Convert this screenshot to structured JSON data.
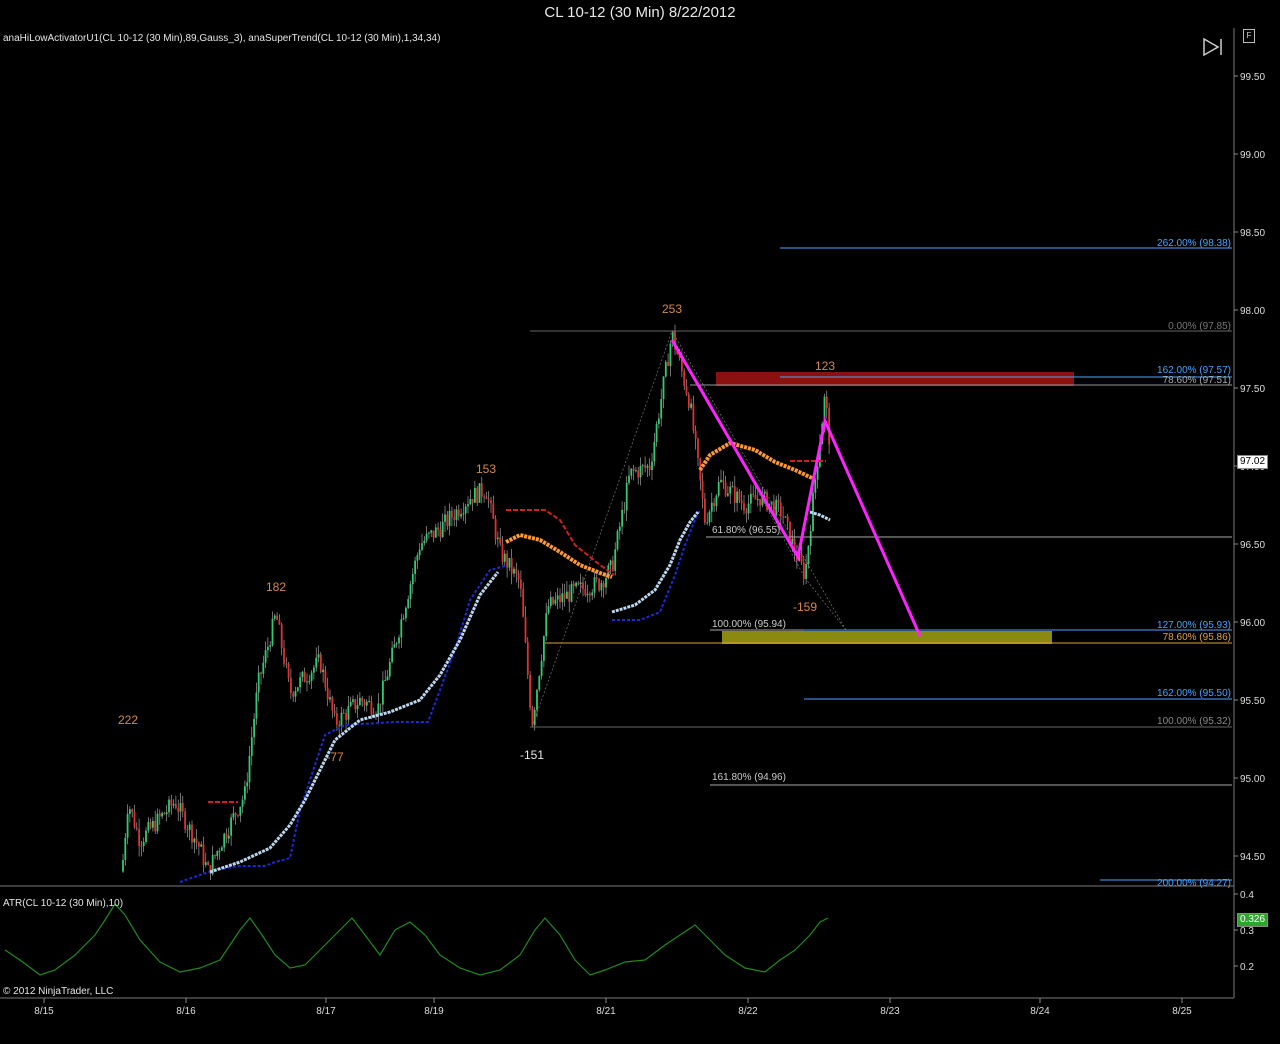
{
  "window": {
    "title": "CL 10-12 (30 Min)  8/22/2012",
    "float_button": "F"
  },
  "panel_price": {
    "indicator_label": "anaHiLowActivatorU1(CL 10-12 (30 Min),89,Gauss_3), anaSuperTrend(CL 10-12 (30 Min),1,34,34)",
    "y_ticks": [
      "99.50",
      "99.00",
      "98.50",
      "98.00",
      "97.50",
      "97.00",
      "96.50",
      "96.00",
      "95.50",
      "95.00",
      "94.50"
    ],
    "current_price": "97.02",
    "swing_labels": [
      "222",
      "182",
      "-77",
      "153",
      "-151",
      "253",
      "123",
      "-159"
    ],
    "fib_labels": [
      "262.00% (98.38)",
      "0.00% (97.85)",
      "162.00% (97.57)",
      "78.60% (97.51)",
      "61.80% (96.55)",
      "100.00% (95.94)",
      "127.00% (95.93)",
      "78.60% (95.86)",
      "162.00% (95.50)",
      "100.00% (95.32)",
      "161.80% (94.96)",
      "200.00% (94.27)"
    ],
    "colors": {
      "bull": "#2ecc71",
      "bear": "#e03030",
      "pattern": "#ff22ff",
      "fib_blue": "#4aa3ff",
      "hilo": "#ff9933",
      "supertrend": "#1c2bd4",
      "supertrend_light": "#bcd8f0"
    }
  },
  "panel_atr": {
    "label": "ATR(CL 10-12 (30 Min),10)",
    "y_ticks": [
      "0.4",
      "0.3",
      "0.2"
    ],
    "current_value": "0.326",
    "color": "#1f8a1f"
  },
  "x_axis": {
    "dates": [
      "8/15",
      "8/16",
      "8/17",
      "8/19",
      "8/21",
      "8/22",
      "8/23",
      "8/24",
      "8/25"
    ]
  },
  "footer": {
    "copyright": "© 2012 NinjaTrader, LLC"
  }
}
